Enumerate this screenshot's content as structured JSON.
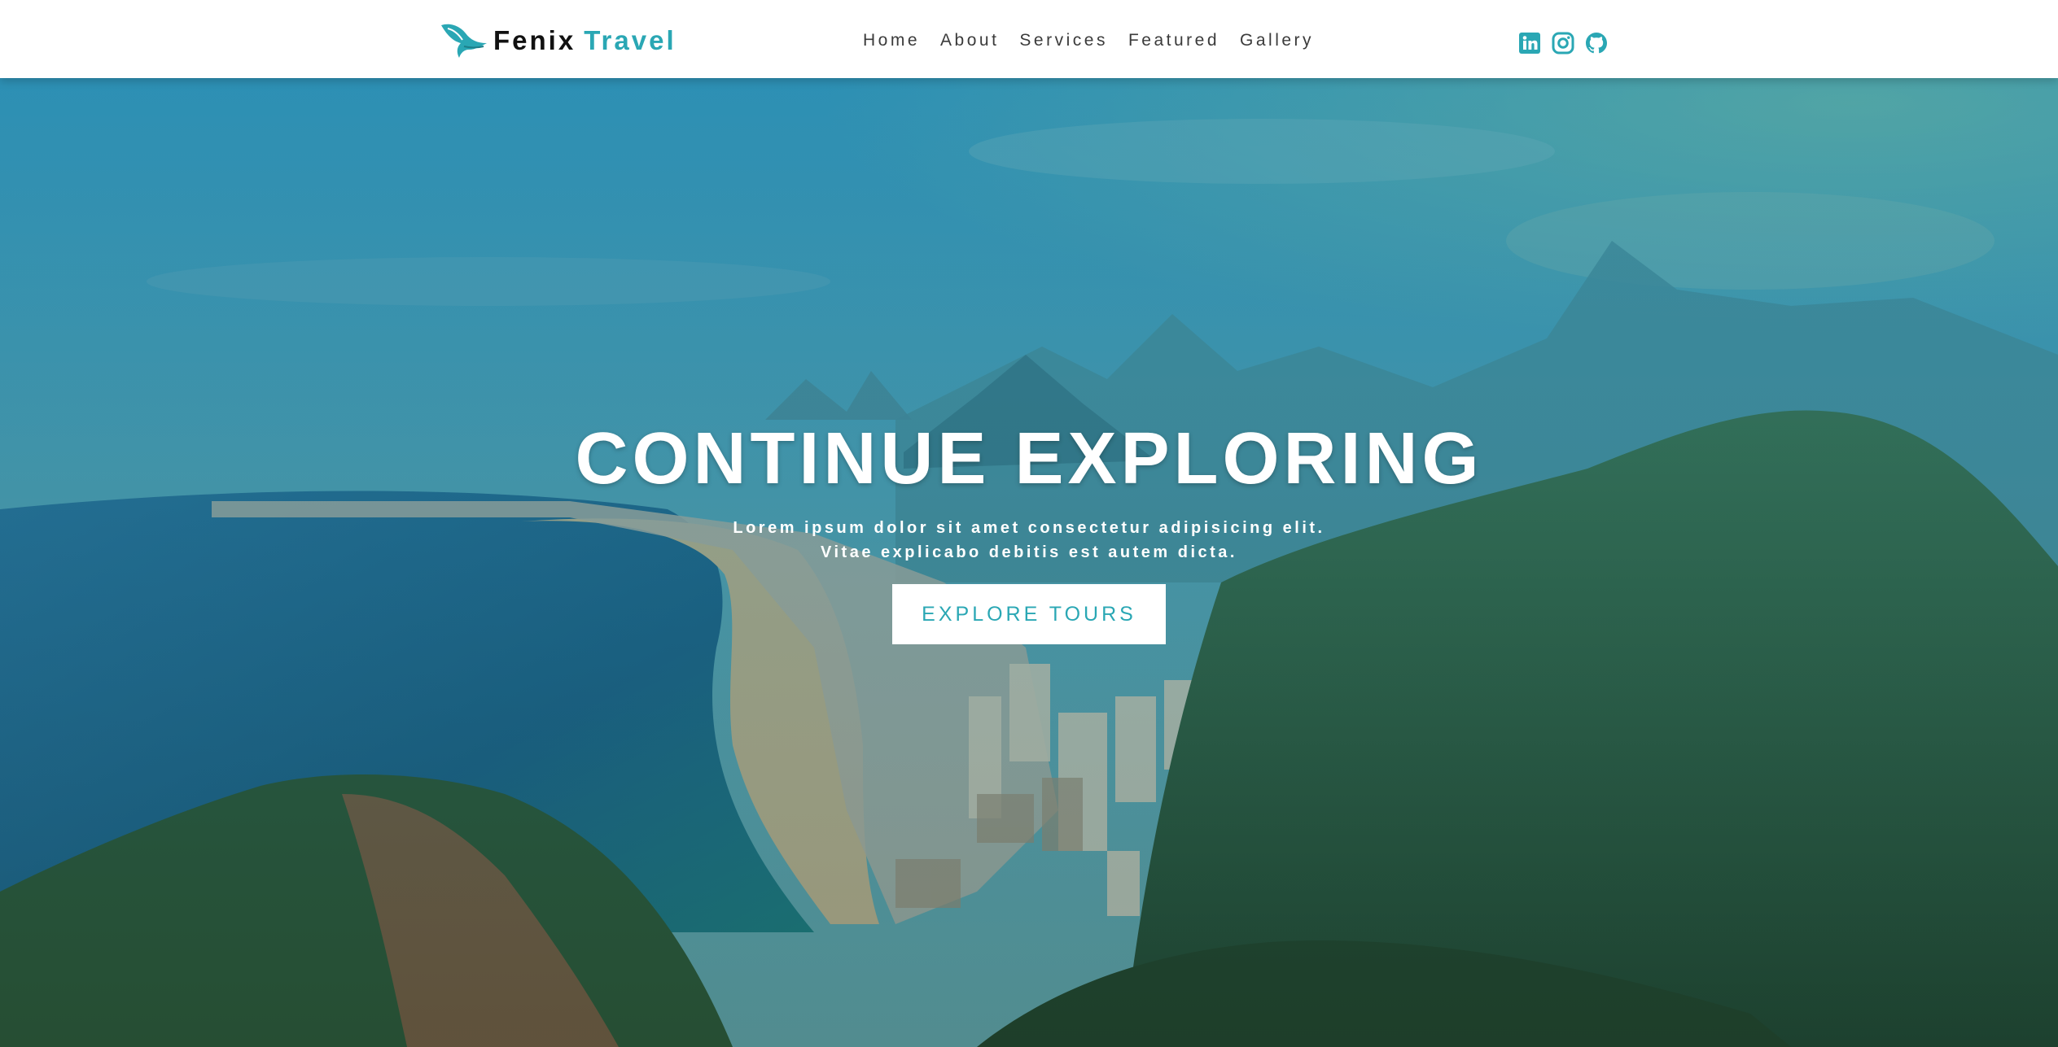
{
  "brand": {
    "first": "Fenix",
    "second": "Travel",
    "logo_icon": "bird-logo-icon",
    "accent_color": "#2aa7b4"
  },
  "nav": {
    "items": [
      "Home",
      "About",
      "Services",
      "Featured",
      "Gallery"
    ]
  },
  "socials": {
    "icons": [
      "linkedin-icon",
      "instagram-icon",
      "github-icon"
    ]
  },
  "hero": {
    "title": "CONTINUE EXPLORING",
    "text": "Lorem ipsum dolor sit amet consectetur adipisicing elit. Vitae explicabo debitis est autem dicta.",
    "button_label": "EXPLORE TOURS"
  }
}
